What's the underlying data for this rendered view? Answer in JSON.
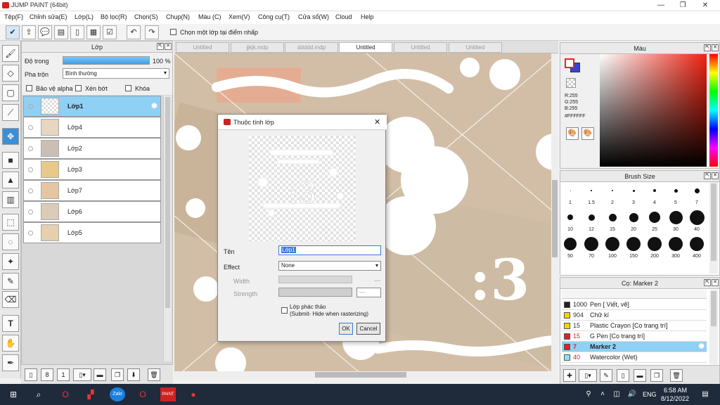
{
  "app": {
    "title": "JUMP PAINT (64bit)"
  },
  "menu": [
    "Tệp(F)",
    "Chỉnh sửa(E)",
    "Lớp(L)",
    "Bộ lọc(R)",
    "Chọn(S)",
    "Chụp(N)",
    "Màu (C)",
    "Xem(V)",
    "Công cụ(T)",
    "Cửa sổ(W)",
    "Cloud",
    "Help"
  ],
  "toolbar": {
    "pick_layer_label": "Chọn một lớp tại điểm nhấp"
  },
  "layer_panel": {
    "title": "Lớp",
    "opacity_label": "Độ trong",
    "opacity_value": "100 %",
    "opacity_percent": 100,
    "blend_label": "Pha trộn",
    "blend_value": "Bình thường",
    "protect_alpha": "Bảo vệ alpha",
    "clipping": "Xén bớt",
    "lock": "Khóa",
    "layers": [
      "Lớp1",
      "Lớp4",
      "Lớp2",
      "Lớp3",
      "Lớp7",
      "Lớp6",
      "Lớp5"
    ]
  },
  "tabs": [
    "Untitled",
    "jjkjk.mdp",
    "ddddd.mdp",
    "Untitled",
    "Untitled",
    "Untitled"
  ],
  "dialog": {
    "title": "Thuộc tính lớp",
    "name_label": "Tên",
    "name_value": "Lớp1",
    "effect_label": "Effect",
    "effect_value": "None",
    "width_label": "Width",
    "width_value": "---",
    "strength_label": "Strength",
    "strength_value": "---",
    "draft_label": "Lớp phác thảo",
    "draft_note": "(Submit- Hide when rasterizing)",
    "ok": "OK",
    "cancel": "Cancel"
  },
  "color_panel": {
    "title": "Màu",
    "r": "R:255",
    "g": "G:255",
    "b": "B:255",
    "hex": "#FFFFFF"
  },
  "brush_size_panel": {
    "title": "Brush Size",
    "sizes": [
      "1",
      "1.5",
      "2",
      "3",
      "4",
      "5",
      "7",
      "10",
      "12",
      "15",
      "20",
      "25",
      "30",
      "40",
      "50",
      "70",
      "100",
      "150",
      "200",
      "300",
      "400"
    ]
  },
  "brush_list": {
    "title": "Cọ: Marker 2",
    "items": [
      {
        "num": "1000",
        "name": "Pen [ Viết, vẽ]",
        "color": "#222222"
      },
      {
        "num": "904",
        "name": "Chữ kí",
        "color": "#f2d600"
      },
      {
        "num": "15",
        "name": "Plastic Crayon [Cọ trang trí]",
        "color": "#f2d600"
      },
      {
        "num": "15",
        "name": "G Pen [Cọ trang trí]",
        "color": "#e22222"
      },
      {
        "num": "7",
        "name": "Marker 2",
        "color": "#e22222"
      },
      {
        "num": "40",
        "name": "Watercolor (Wet)",
        "color": "#7fe8f5"
      }
    ]
  },
  "taskbar": {
    "time": "6:58 AM",
    "date": "8/12/2022",
    "lang": "ENG"
  }
}
